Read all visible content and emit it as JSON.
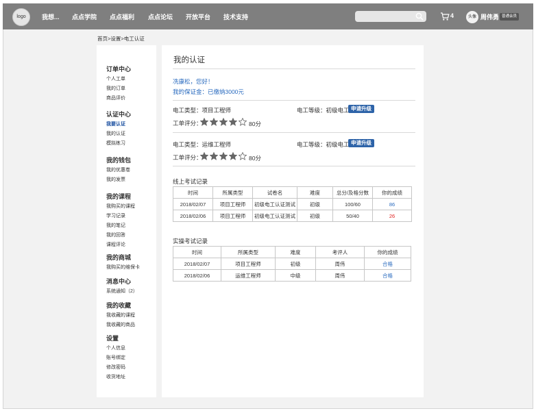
{
  "header": {
    "logo_text": "logo",
    "nav": [
      "我想...",
      "点点学院",
      "点点福利",
      "点点论坛",
      "开放平台",
      "技术支持"
    ],
    "cart_count": "4",
    "avatar_text": "头像",
    "username": "周伟勇",
    "member_badge": "普通会员"
  },
  "breadcrumb": "首页>设置>电工认证",
  "sidebar": {
    "groups": [
      {
        "title": "订单中心",
        "items": [
          "个人工单",
          "我的订单",
          "商品评价"
        ]
      },
      {
        "title": "认证中心",
        "items": [
          "我要认证",
          "我的认证",
          "模拟练习"
        ]
      },
      {
        "title": "我的钱包",
        "items": [
          "我的优惠卷",
          "我的发票"
        ]
      },
      {
        "title": "我的课程",
        "items": [
          "我购买的课程",
          "学习记录",
          "我的笔记",
          "我的回答",
          "课程评论"
        ]
      },
      {
        "title": "我的商城",
        "items": [
          "我购买的维保卡"
        ]
      },
      {
        "title": "消息中心",
        "items": [
          "系统通知（2）"
        ]
      },
      {
        "title": "我的收藏",
        "items": [
          "我收藏的课程",
          "我收藏的商品"
        ]
      },
      {
        "title": "设置",
        "items": [
          "个人信息",
          "账号绑定",
          "修改密码",
          "收货地址"
        ]
      }
    ],
    "active_item": "我要认证"
  },
  "main": {
    "title": "我的认证",
    "greeting": "冼康松，您好！",
    "deposit": "我的保证金：已缴纳3000元",
    "certs": [
      {
        "type_label": "电工类型：",
        "type": "项目工程师",
        "level_label": "电工等级：",
        "level": "初级电工",
        "upgrade": "申请升级",
        "rating_label": "工单评分：",
        "stars_filled": 4,
        "stars_total": 5,
        "score": "80分"
      },
      {
        "type_label": "电工类型：",
        "type": "运维工程师",
        "level_label": "电工等级：",
        "level": "初级电工",
        "upgrade": "申请升级",
        "rating_label": "工单评分：",
        "stars_filled": 4,
        "stars_total": 5,
        "score": "80分"
      }
    ],
    "online_exam": {
      "title": "线上考试记录",
      "headers": [
        "时间",
        "所属类型",
        "试卷名",
        "难度",
        "总分/及格分数",
        "你的成绩"
      ],
      "rows": [
        [
          "2018/02/07",
          "项目工程师",
          "初级电工认证测试",
          "初级",
          "100/60",
          "86"
        ],
        [
          "2018/02/06",
          "项目工程师",
          "初级电工认证测试",
          "初级",
          "50/40",
          "26"
        ]
      ]
    },
    "practical_exam": {
      "title": "实操考试记录",
      "headers": [
        "时间",
        "所属类型",
        "难度",
        "考评人",
        "你的成绩"
      ],
      "rows": [
        [
          "2018/02/07",
          "项目工程师",
          "初级",
          "周伟",
          "合格"
        ],
        [
          "2018/02/06",
          "运维工程师",
          "中级",
          "周伟",
          "合格"
        ]
      ]
    }
  },
  "colors": {
    "pass": "#2a6bbf",
    "fail": "#e0201e",
    "accent": "#2d63a8",
    "topbar": "#7f7f7f"
  }
}
